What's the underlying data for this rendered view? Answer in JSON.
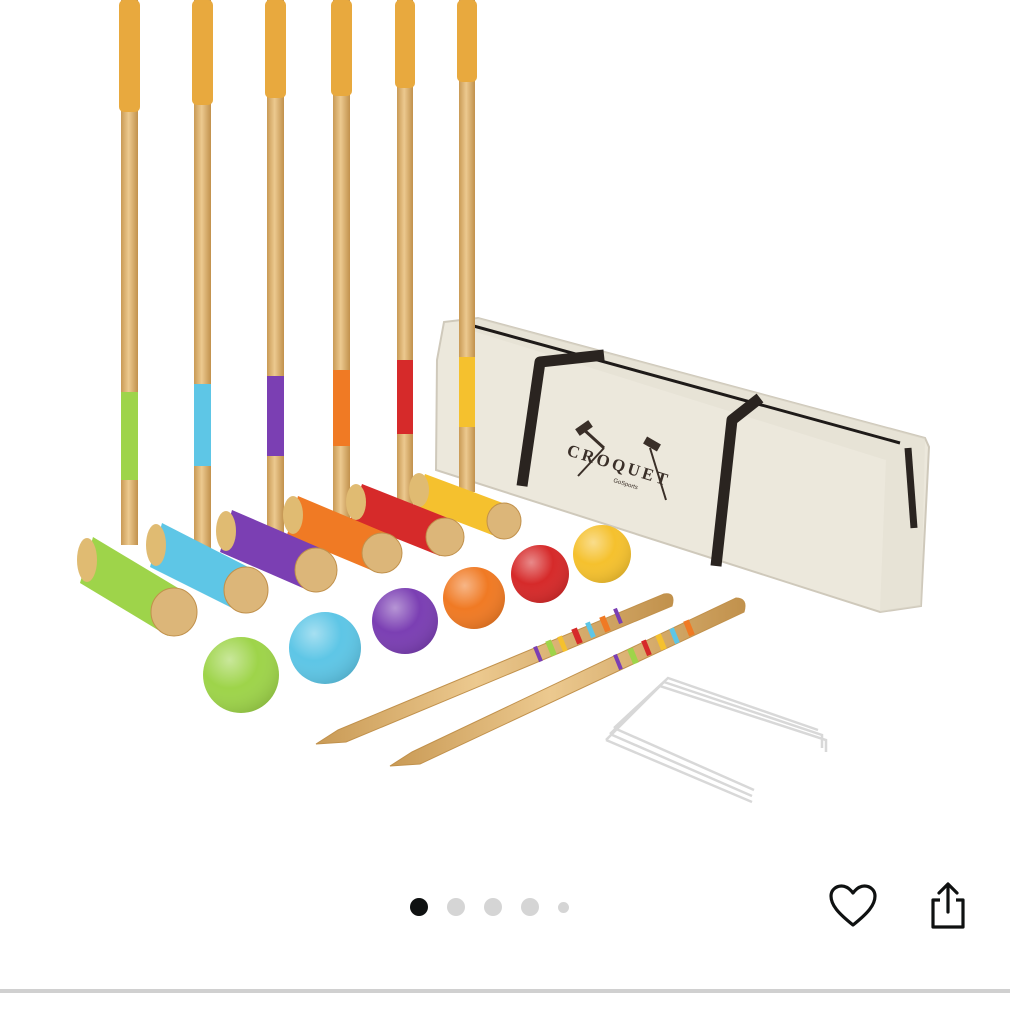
{
  "product_image": {
    "bag_text": "CROQUET",
    "bag_subtext": "GoSports",
    "colors": {
      "wood": "#dcb679",
      "grip": "#e8a93e",
      "bag": "#ece8dc",
      "strap": "#2a2420",
      "accent": [
        "#9ed44a",
        "#5ec6e6",
        "#7b3fb3",
        "#f07a24",
        "#d62a2a",
        "#f5c12e"
      ]
    }
  },
  "carousel": {
    "total": 5,
    "current": 1,
    "dot_color": "#d5d5d5",
    "active_color": "#0f1111"
  },
  "actions": {
    "favorite_icon": "heart-outline-icon",
    "share_icon": "share-icon"
  }
}
